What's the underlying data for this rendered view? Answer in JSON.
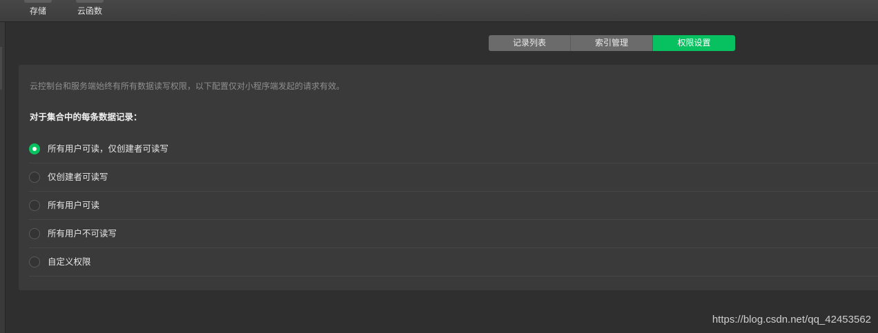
{
  "toolbar": {
    "items": [
      {
        "label": "存储",
        "icon": "storage-icon"
      },
      {
        "label": "云函数",
        "icon": "cloud-function-icon"
      }
    ]
  },
  "tabs": [
    {
      "label": "记录列表",
      "active": false
    },
    {
      "label": "索引管理",
      "active": false
    },
    {
      "label": "权限设置",
      "active": true
    }
  ],
  "panel": {
    "notice": "云控制台和服务端始终有所有数据读写权限，以下配置仅对小程序端发起的请求有效。",
    "heading": "对于集合中的每条数据记录：",
    "options": [
      {
        "label": "所有用户可读，仅创建者可读写",
        "checked": true
      },
      {
        "label": "仅创建者可读写",
        "checked": false
      },
      {
        "label": "所有用户可读",
        "checked": false
      },
      {
        "label": "所有用户不可读写",
        "checked": false
      },
      {
        "label": "自定义权限",
        "checked": false
      }
    ]
  },
  "watermark": "https://blog.csdn.net/qq_42453562",
  "colors": {
    "accent": "#07c160",
    "background": "#2f2f2f",
    "panel": "#3a3a3a"
  }
}
